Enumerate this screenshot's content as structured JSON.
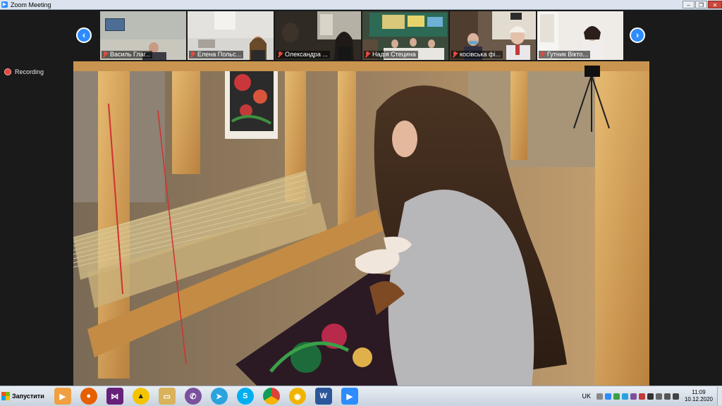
{
  "window": {
    "title": "Zoom Meeting",
    "minimize_glyph": "–",
    "restore_glyph": "❐",
    "close_glyph": "✕"
  },
  "recording": {
    "label": "Recording",
    "icon": "recording-dot-icon"
  },
  "gallery": {
    "prev_glyph": "‹",
    "next_glyph": "›",
    "participants": [
      {
        "name": "Василь Глаг...",
        "muted": true
      },
      {
        "name": "Елена Польс...",
        "muted": true
      },
      {
        "name": "Олександра ...",
        "muted": true
      },
      {
        "name": "Надія Стецина",
        "muted": true
      },
      {
        "name": "косівська фі...",
        "muted": true
      },
      {
        "name": "Гутник Вікто...",
        "muted": true
      }
    ]
  },
  "taskbar": {
    "start_label": "Запустити",
    "apps": [
      {
        "icon": "media-player-icon",
        "color": "#f0a040"
      },
      {
        "icon": "firefox-icon",
        "color": "#e66000"
      },
      {
        "icon": "visual-studio-icon",
        "color": "#68217a"
      },
      {
        "icon": "archicad-icon",
        "color": "#f5c400"
      },
      {
        "icon": "folder-icon",
        "color": "#d9b25a"
      },
      {
        "icon": "viber-icon",
        "color": "#7b519d"
      },
      {
        "icon": "telegram-icon",
        "color": "#2aa3df"
      },
      {
        "icon": "skype-icon",
        "color": "#00aff0"
      },
      {
        "icon": "chrome-icon",
        "color": "#3a9a3a"
      },
      {
        "icon": "app-yellow-icon",
        "color": "#f0b400"
      },
      {
        "icon": "word-icon",
        "color": "#2b579a"
      },
      {
        "icon": "zoom-icon",
        "color": "#2d8cff"
      }
    ],
    "language": "UK",
    "time": "11:09",
    "date": "10.12.2020"
  }
}
